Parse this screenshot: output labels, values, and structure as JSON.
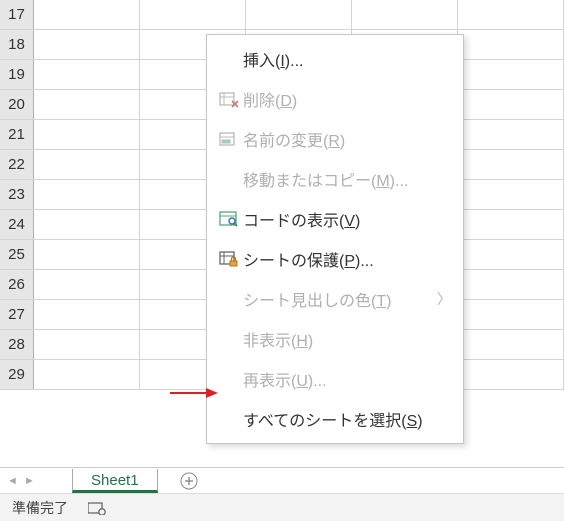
{
  "rows": [
    "17",
    "18",
    "19",
    "20",
    "21",
    "22",
    "23",
    "24",
    "25",
    "26",
    "27",
    "28",
    "29"
  ],
  "sheet_tab": "Sheet1",
  "status": {
    "ready": "準備完了"
  },
  "menu": {
    "insert": {
      "label": "挿入(",
      "key": "I",
      "suffix": ")..."
    },
    "delete": {
      "label": "削除(",
      "key": "D",
      "suffix": ")"
    },
    "rename": {
      "label": "名前の変更(",
      "key": "R",
      "suffix": ")"
    },
    "move": {
      "label": "移動またはコピー(",
      "key": "M",
      "suffix": ")..."
    },
    "viewcode": {
      "label": "コードの表示(",
      "key": "V",
      "suffix": ")"
    },
    "protect": {
      "label": "シートの保護(",
      "key": "P",
      "suffix": ")..."
    },
    "tabcolor": {
      "label": "シート見出しの色(",
      "key": "T",
      "suffix": ")"
    },
    "hide": {
      "label": "非表示(",
      "key": "H",
      "suffix": ")"
    },
    "unhide": {
      "label": "再表示(",
      "key": "U",
      "suffix": ")..."
    },
    "selectall": {
      "label": "すべてのシートを選択(",
      "key": "S",
      "suffix": ")"
    }
  }
}
